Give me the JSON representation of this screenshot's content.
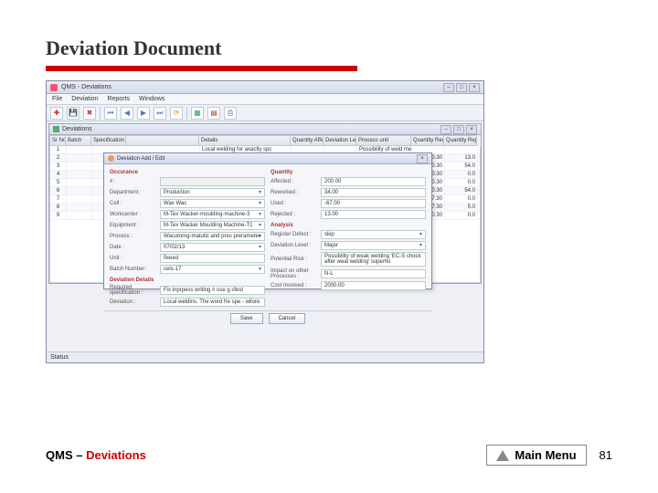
{
  "slide": {
    "title": "Deviation Document",
    "breadcrumb_main": "QMS – ",
    "breadcrumb_sub": "Deviations",
    "main_menu_label": "Main Menu",
    "page_number": "81"
  },
  "app": {
    "title": "QMS - Deviations",
    "menubar": [
      "File",
      "Deviation",
      "Reports",
      "Windows"
    ],
    "toolbar_icons": [
      "new",
      "save",
      "delete",
      "sep",
      "nav-first",
      "nav-prev",
      "nav-next",
      "nav-last",
      "refresh",
      "sep",
      "excel",
      "pdf",
      "print"
    ],
    "sub_window_title": "Deviations",
    "status_text": "Status"
  },
  "grid": {
    "headers": [
      "Sr No",
      "Batch",
      "Specification",
      "",
      "Details",
      "Quantity Affected",
      "Deviation Level",
      "Process unit",
      "Quantity Reworked",
      "Quantity Rejected"
    ],
    "rows": [
      {
        "sr": "1",
        "batch": "",
        "spec": "",
        "blank": "",
        "details": "Local welding for axactly spc",
        "qtyA": "",
        "lvl": "",
        "proc": "Possibility of weld melting 'K' S",
        "qtyR": "",
        "qtyJ": ""
      },
      {
        "sr": "2",
        "batch": "",
        "spec": "",
        "blank": "",
        "details": "",
        "qtyA": "",
        "lvl": "",
        "proc": "",
        "qtyR": "0.30",
        "qtyJ": "13.0"
      },
      {
        "sr": "3",
        "batch": "",
        "spec": "",
        "blank": "",
        "details": "",
        "qtyA": "",
        "lvl": "",
        "proc": "",
        "qtyR": "0.30",
        "qtyJ": "54.0"
      },
      {
        "sr": "4",
        "batch": "",
        "spec": "",
        "blank": "",
        "details": "",
        "qtyA": "",
        "lvl": "",
        "proc": "",
        "qtyR": "0.30",
        "qtyJ": "0.0"
      },
      {
        "sr": "5",
        "batch": "",
        "spec": "",
        "blank": "",
        "details": "",
        "qtyA": "",
        "lvl": "",
        "proc": "",
        "qtyR": "0.30",
        "qtyJ": "0.0"
      },
      {
        "sr": "6",
        "batch": "",
        "spec": "",
        "blank": "",
        "details": "",
        "qtyA": "",
        "lvl": "",
        "proc": "",
        "qtyR": "40.30",
        "qtyJ": "54.0"
      },
      {
        "sr": "7",
        "batch": "",
        "spec": "",
        "blank": "",
        "details": "",
        "qtyA": "",
        "lvl": "",
        "proc": "",
        "qtyR": "7.30",
        "qtyJ": "0.0"
      },
      {
        "sr": "8",
        "batch": "",
        "spec": "",
        "blank": "",
        "details": "",
        "qtyA": "",
        "lvl": "",
        "proc": "",
        "qtyR": "7.30",
        "qtyJ": "5.0"
      },
      {
        "sr": "9",
        "batch": "",
        "spec": "",
        "blank": "",
        "details": "",
        "qtyA": "",
        "lvl": "",
        "proc": "",
        "qtyR": "0.30",
        "qtyJ": "0.0"
      }
    ]
  },
  "dialog": {
    "title": "Deviation Add / Edit",
    "left": {
      "occurance": {
        "label": "Occurance",
        "value": ""
      },
      "id": {
        "label": "# :",
        "value": ""
      },
      "department": {
        "label": "Department :",
        "value": "Production"
      },
      "cell": {
        "label": "Cell :",
        "value": "Wax Wac"
      },
      "workcenter": {
        "label": "Workcenter :",
        "value": "M-Tex Wacker-moulding-machine-3"
      },
      "equipment": {
        "label": "Equipment :",
        "value": "M-Tex Wacker Moulding Machine-T1"
      },
      "process": {
        "label": "Process :",
        "value": "Wacutomg-matutic and pres prerameter"
      },
      "date": {
        "label": "Date :",
        "value": "07/02/13"
      },
      "unit": {
        "label": "Unit :",
        "value": "fixeed"
      },
      "batch_number": {
        "label": "Batch Number :",
        "value": "cels-17"
      },
      "section_head": "Deviation Details",
      "required_spec": {
        "label": "Required specification :",
        "value": "Fix inprpess writing # use g sfest"
      },
      "deviation": {
        "label": "Deviation :",
        "value": "Local weldins. The word fre spe - wllore."
      }
    },
    "right": {
      "section_head": "Quantity",
      "affected": {
        "label": "Affected :",
        "value": "200.00"
      },
      "reworked": {
        "label": "Reworked :",
        "value": "34.00"
      },
      "used": {
        "label": "Used :",
        "value": "-67.00"
      },
      "rejected": {
        "label": "Rejected :",
        "value": "13.00"
      },
      "analysis_head": "Analysis",
      "register_defect": {
        "label": "Register Defect :",
        "value": "skip"
      },
      "deviation_level": {
        "label": "Deviation Level :",
        "value": "Major"
      },
      "potential_risk": {
        "label": "Potential Risk :",
        "value": "Possibility of weak welding 'EC-S chock after weal welding' superho"
      },
      "impact_on": {
        "label": "Impact on other Processes :",
        "value": "N-L"
      },
      "cost_involved": {
        "label": "Cost Involved :",
        "value": "2000.00"
      }
    },
    "buttons": {
      "save": "Save",
      "cancel": "Cancel"
    }
  }
}
